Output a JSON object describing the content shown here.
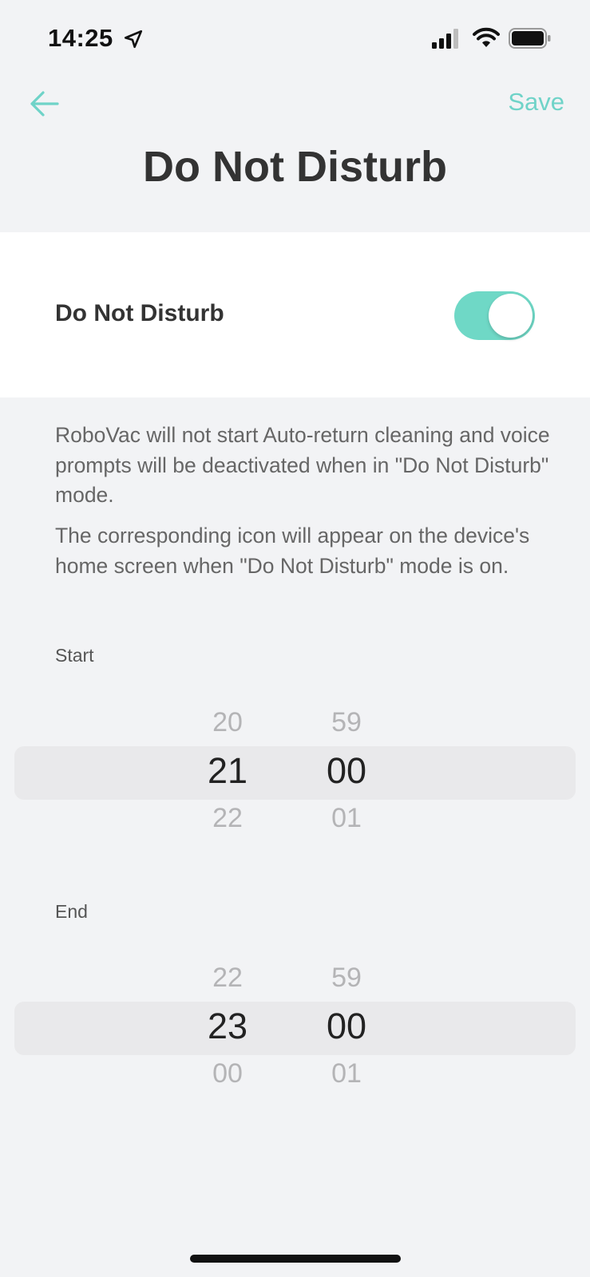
{
  "status_bar": {
    "time": "14:25",
    "icons": [
      "location-arrow-icon",
      "cellular-signal-icon",
      "wifi-icon",
      "battery-icon"
    ]
  },
  "nav": {
    "back_icon": "arrow-left-icon",
    "save_label": "Save",
    "title": "Do Not Disturb"
  },
  "toggle": {
    "label": "Do Not Disturb",
    "enabled": true,
    "color": "#6fd8c6"
  },
  "descriptions": [
    "RoboVac will not start Auto-return cleaning and voice prompts will be deactivated when in \"Do Not Disturb\" mode.",
    "The corresponding icon will appear on the device's home screen when \"Do Not Disturb\" mode is on."
  ],
  "start": {
    "label": "Start",
    "hour": {
      "prev": "20",
      "current": "21",
      "next": "22"
    },
    "minute": {
      "prev": "59",
      "current": "00",
      "next": "01"
    }
  },
  "end": {
    "label": "End",
    "hour": {
      "prev": "22",
      "current": "23",
      "next": "00"
    },
    "minute": {
      "prev": "59",
      "current": "00",
      "next": "01"
    }
  },
  "colors": {
    "accent": "#6fd3c8",
    "background": "#f2f3f5"
  }
}
